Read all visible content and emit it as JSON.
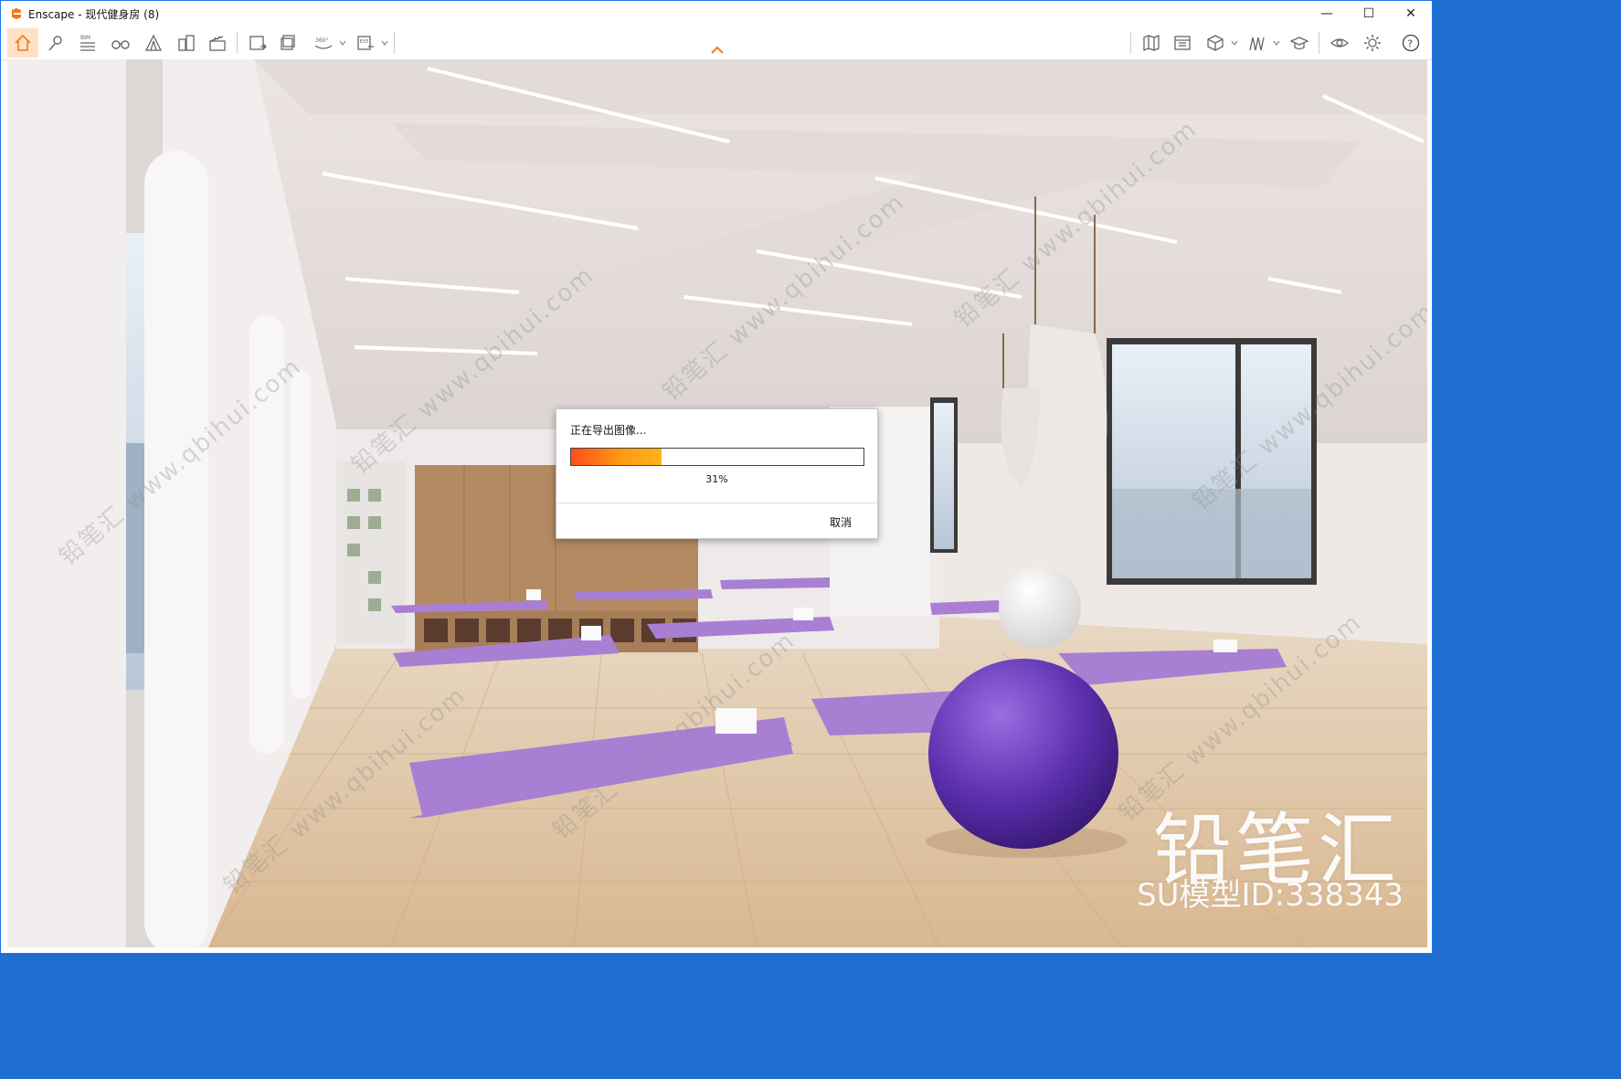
{
  "window": {
    "app_name": "Enscape",
    "title": "Enscape - 现代健身房 (8)",
    "controls": {
      "minimize": "—",
      "maximize": "☐",
      "close": "✕"
    }
  },
  "toolbar": {
    "groups": [
      [
        "home-icon",
        "location-pin-icon",
        "bim-icon",
        "binoculars-icon",
        "tent-icon",
        "buildings-icon",
        "clapperboard-icon"
      ],
      [
        "screenshot-export-icon",
        "batch-export-icon",
        "panorama-360-icon",
        "exe-export-icon"
      ],
      [
        "map-icon",
        "asset-library-icon",
        "cube-view-icon",
        "atmosphere-icon",
        "graduation-cap-icon"
      ],
      [
        "eye-icon",
        "gear-icon",
        "help-icon"
      ]
    ],
    "bim_label": "BIM",
    "pano_label": "360°",
    "exe_label": "EXE",
    "help_label": "?"
  },
  "dialog": {
    "title": "正在导出图像...",
    "progress": 0.31,
    "progress_text": "31%",
    "cancel_label": "取消"
  },
  "watermark": {
    "brand": "铅笔汇",
    "model_id": "SU模型ID:338343",
    "diag_text": "铅笔汇 www.qbihui.com"
  },
  "colors": {
    "accent": "#f07a1a",
    "progress_start": "#ff4d1a",
    "progress_end": "#ffb319",
    "mat": "#a97fd3",
    "ball": "#6a3fb4"
  }
}
